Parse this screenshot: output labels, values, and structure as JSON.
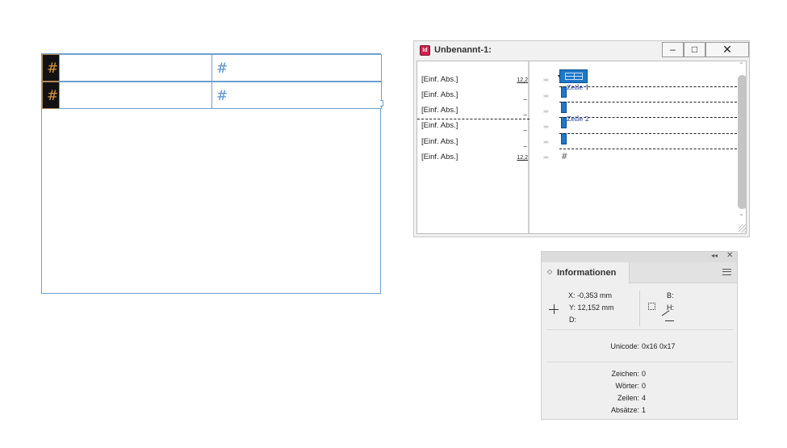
{
  "table_frame": {
    "rows": [
      {
        "cells": [
          "#",
          "",
          "#"
        ]
      },
      {
        "cells": [
          "#",
          "",
          "#"
        ]
      }
    ]
  },
  "story_editor": {
    "title": "Unbenannt-1:",
    "app_icon": "Id",
    "buttons": {
      "minimize": "–",
      "maximize": "□",
      "close": "✕"
    },
    "rows": [
      {
        "style": "[Einf. Abs.]",
        "depth": "12,2"
      },
      {
        "style": "[Einf. Abs.]",
        "depth": "_"
      },
      {
        "style": "[Einf. Abs.]",
        "depth": "_"
      },
      {
        "style": "[Einf. Abs.]",
        "depth": "_"
      },
      {
        "style": "[Einf. Abs.]",
        "depth": "_"
      },
      {
        "style": "[Einf. Abs.]",
        "depth": "12,2"
      }
    ],
    "chevrons": "»»",
    "row_labels": [
      "Zeile 1",
      "Zeile 2"
    ],
    "end_text": "#"
  },
  "info_panel": {
    "collapse_icon": "◂◂",
    "close_icon": "✕",
    "tab_arrow": "◇",
    "tab_label": "Informationen",
    "x": "X: -0,353 mm",
    "y": "Y: 12,152 mm",
    "d": "D:",
    "b": "B:",
    "h": "H:",
    "unicode_label": "Unicode:",
    "unicode_value": "0x16 0x17",
    "stats": [
      {
        "label": "Zeichen:",
        "value": "0"
      },
      {
        "label": "Wörter:",
        "value": "0"
      },
      {
        "label": "Zeilen:",
        "value": "4"
      },
      {
        "label": "Absätze:",
        "value": "1"
      }
    ]
  },
  "colors": {
    "frame_stroke": "#6f9fd0",
    "selection_fill": "#1f77c8",
    "header_cell": "#121212",
    "header_glyph": "#d6923d"
  }
}
